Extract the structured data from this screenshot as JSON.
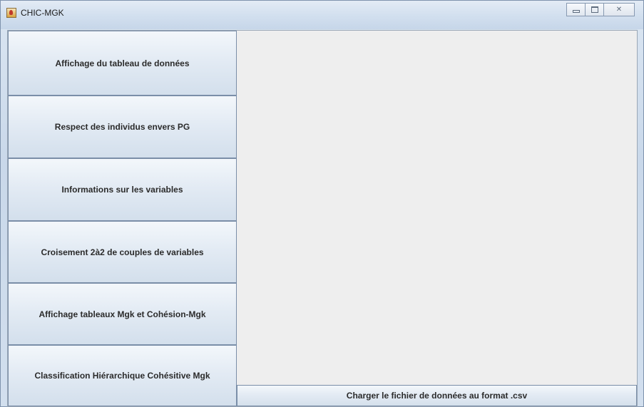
{
  "window": {
    "title": "CHIC-MGK",
    "controls": {
      "minimize_icon": "minimize-icon",
      "maximize_icon": "maximize-icon",
      "close_icon": "close-icon",
      "close_glyph": "✕"
    }
  },
  "sidebar": {
    "items": [
      {
        "label": "Affichage du tableau de données"
      },
      {
        "label": "Respect des individus envers PG"
      },
      {
        "label": "Informations sur les variables"
      },
      {
        "label": "Croisement 2à2 de couples de variables"
      },
      {
        "label": "Affichage tableaux Mgk et Cohésion-Mgk"
      },
      {
        "label": "Classification Hiérarchique Cohésitive Mgk"
      }
    ]
  },
  "main": {
    "load_button_label": "Charger le fichier de données au format .csv"
  },
  "colors": {
    "button_border": "#7a8ea8",
    "content_background": "#eeeeee",
    "titlebar": "#d3e0ef"
  }
}
